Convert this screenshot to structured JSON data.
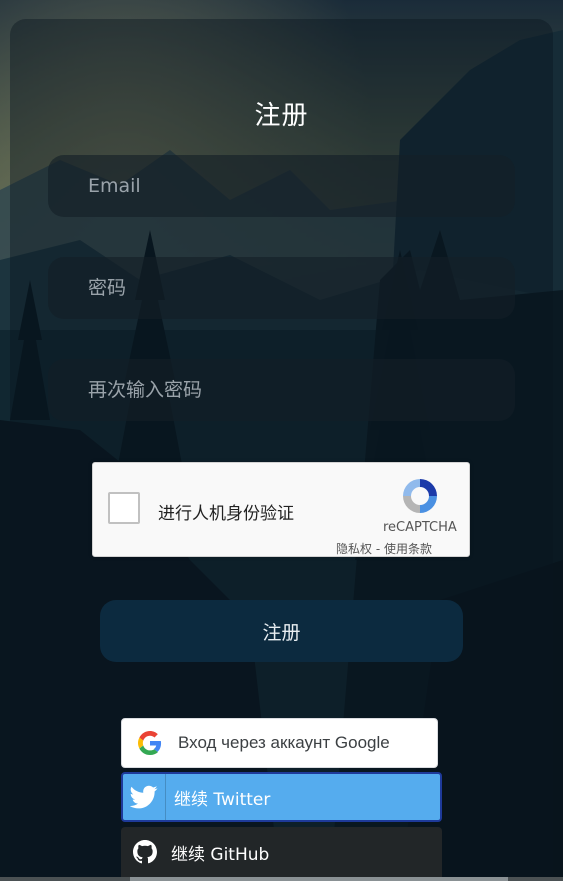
{
  "form": {
    "title": "注册",
    "email_placeholder": "Email",
    "password_placeholder": "密码",
    "confirm_placeholder": "再次输入密码",
    "submit_label": "注册"
  },
  "captcha": {
    "label": "进行人机身份验证",
    "brand": "reCAPTCHA",
    "terms": "隐私权 - 使用条款",
    "icon": "recaptcha-logo-icon"
  },
  "oauth": {
    "google": {
      "label": "Вход через аккаунт Google",
      "icon": "google-icon",
      "color": "#ffffff"
    },
    "twitter": {
      "label": "继续 Twitter",
      "icon": "twitter-bird-icon",
      "color": "#55acee"
    },
    "github": {
      "label": "继续 GitHub",
      "icon": "github-octocat-icon",
      "color": "#222628"
    }
  }
}
